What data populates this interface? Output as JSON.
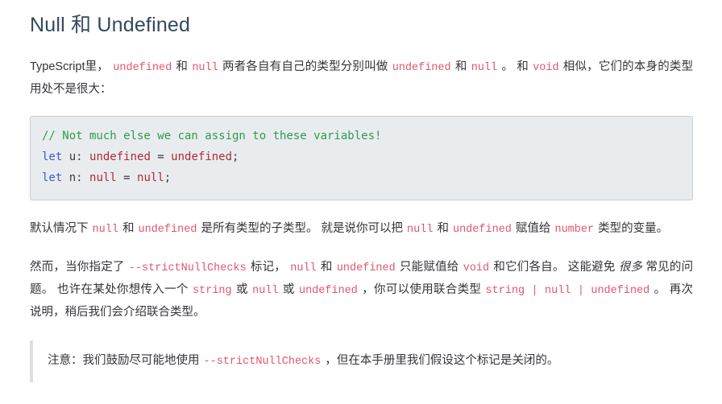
{
  "page": {
    "heading": "Null 和 Undefined"
  },
  "paragraphs": {
    "intro": {
      "t1": "TypeScript里，",
      "c1": "undefined",
      "t2": "和",
      "c2": "null",
      "t3": "两者各自有自己的类型分别叫做",
      "c3": "undefined",
      "t4": "和",
      "c4": "null",
      "t5": "。 和",
      "c5": "void",
      "t6": "相似，它们的本身的类型用处不是很大："
    },
    "subtypes": {
      "t1": "默认情况下",
      "c1": "null",
      "t2": "和",
      "c2": "undefined",
      "t3": "是所有类型的子类型。 就是说你可以把",
      "c3": "null",
      "t4": "和",
      "c4": "undefined",
      "t5": "赋值给",
      "c5": "number",
      "t6": "类型的变量。"
    },
    "strict": {
      "t1": "然而，当你指定了",
      "c1": "--strictNullChecks",
      "t2": "标记，",
      "c2": "null",
      "t3": "和",
      "c3": "undefined",
      "t4": "只能赋值给",
      "c4": "void",
      "t5": "和它们各自。 这能避免",
      "em1": "很多",
      "t6": "常见的问题。 也许在某处你想传入一个",
      "c5": "string",
      "t7": "或",
      "c6": "null",
      "t8": "或",
      "c7": "undefined",
      "t9": "，你可以使用联合类型",
      "c8": "string | null | undefined",
      "t10": "。 再次说明，稍后我们会介绍联合类型。"
    }
  },
  "codeblock": {
    "language": "ts",
    "lines": [
      {
        "tokens": [
          {
            "text": "// Not much else we can assign to these variables!",
            "type": "comment"
          }
        ]
      },
      {
        "tokens": [
          {
            "text": "let",
            "type": "keyword"
          },
          {
            "text": " u: ",
            "type": "plain"
          },
          {
            "text": "undefined",
            "type": "type"
          },
          {
            "text": " = ",
            "type": "plain"
          },
          {
            "text": "undefined",
            "type": "type"
          },
          {
            "text": ";",
            "type": "punct"
          }
        ]
      },
      {
        "tokens": [
          {
            "text": "let",
            "type": "keyword"
          },
          {
            "text": " n: ",
            "type": "plain"
          },
          {
            "text": "null",
            "type": "type"
          },
          {
            "text": " = ",
            "type": "plain"
          },
          {
            "text": "null",
            "type": "type"
          },
          {
            "text": ";",
            "type": "punct"
          }
        ]
      }
    ],
    "raw": "// Not much else we can assign to these variables!\nlet u: undefined = undefined;\nlet n: null = null;"
  },
  "note": {
    "t1": "注意：我们鼓励尽可能地使用",
    "c1": "--strictNullChecks",
    "t2": "，但在本手册里我们假设这个标记是关闭的。"
  },
  "colors": {
    "heading": "#34495e",
    "body_text": "#34343a",
    "inline_code": "#e0566f",
    "code_background": "#e9ecef",
    "code_border": "#c9cdd2",
    "code_comment": "#2e9b4a",
    "code_keyword": "#3f56d6",
    "code_type": "#b02a37",
    "blockquote_border": "#dcdfe3",
    "page_background": "#ffffff"
  }
}
